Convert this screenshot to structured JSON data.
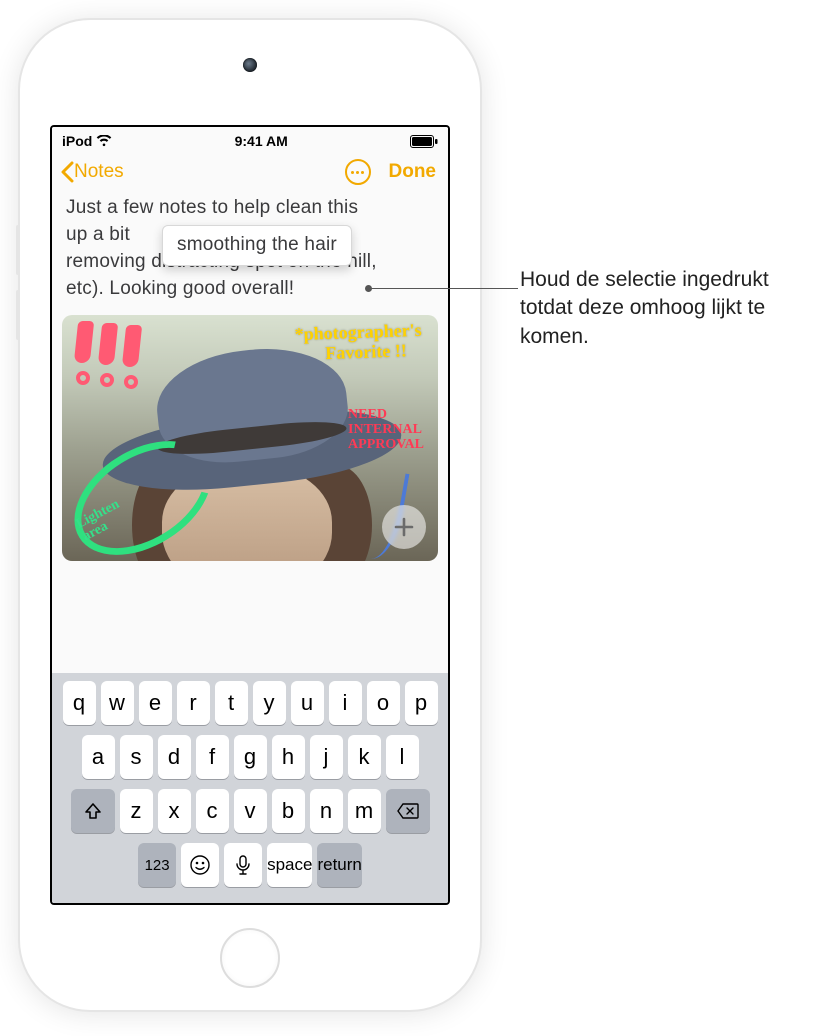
{
  "statusbar": {
    "device": "iPod",
    "time": "9:41 AM"
  },
  "nav": {
    "back_label": "Notes",
    "done_label": "Done"
  },
  "note": {
    "line1": "Just a few notes to help clean this",
    "line2": "up a bit",
    "line3": "removing distracting spot on the hill,",
    "line4": "etc). Looking good overall!",
    "selection_popup": "smoothing the hair"
  },
  "annotations": {
    "favorite_line1": "*photographer's",
    "favorite_line2": "Favorite !!",
    "approval_line1": "NEED",
    "approval_line2": "INTERNAL",
    "approval_line3": "APPROVAL",
    "lighten_line1": "Lighten",
    "lighten_line2": "area"
  },
  "keyboard": {
    "row1": [
      "q",
      "w",
      "e",
      "r",
      "t",
      "y",
      "u",
      "i",
      "o",
      "p"
    ],
    "row2": [
      "a",
      "s",
      "d",
      "f",
      "g",
      "h",
      "j",
      "k",
      "l"
    ],
    "row3": [
      "z",
      "x",
      "c",
      "v",
      "b",
      "n",
      "m"
    ],
    "numbers_label": "123",
    "space_label": "space",
    "return_label": "return"
  },
  "callout": {
    "text": "Houd de selectie ingedrukt totdat deze omhoog lijkt te komen."
  }
}
